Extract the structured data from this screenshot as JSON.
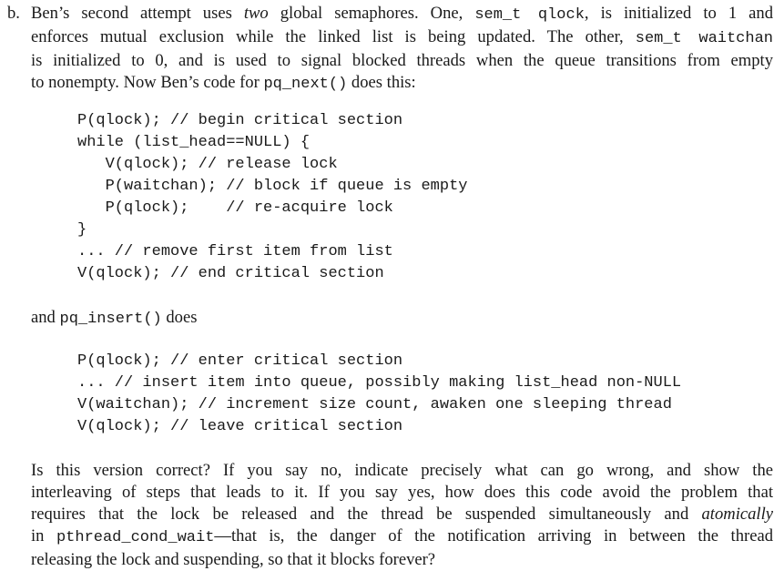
{
  "part_b": {
    "label": "b.",
    "lines": [
      [
        "Ben’s second attempt uses ",
        {
          "em": "two"
        },
        " global semaphores. One, ",
        {
          "tt": "sem_t qlock"
        },
        ", is initialized to 1 and"
      ],
      [
        "enforces mutual exclusion while the linked list is being updated. The other, ",
        {
          "tt": "sem_t waitchan"
        }
      ],
      [
        "is initialized to 0, and is used to signal blocked threads when the queue transitions from empty"
      ],
      [
        "to nonempty. Now Ben’s code for ",
        {
          "tt": "pq_next()"
        },
        " does this:"
      ]
    ]
  },
  "pq_next_code": [
    "P(qlock); // begin critical section",
    "while (list_head==NULL) {",
    "   V(qlock); // release lock",
    "   P(waitchan); // block if queue is empty",
    "   P(qlock);    // re-acquire lock",
    "}",
    "... // remove first item from list",
    "V(qlock); // end critical section"
  ],
  "insert_intro": {
    "before": "and ",
    "func": "pq_insert()",
    "after": " does"
  },
  "pq_insert_code": [
    "P(qlock); // enter critical section",
    "... // insert item into queue, possibly making list_head non-NULL",
    "V(waitchan); // increment size count, awaken one sleeping thread",
    "V(qlock); // leave critical section"
  ],
  "question": {
    "lines": [
      [
        "Is this version correct? If you say no, indicate precisely what can go wrong, and show the"
      ],
      [
        "interleaving of steps that leads to it. If you say yes, how does this code avoid the problem that"
      ],
      [
        "requires that the lock be released and the thread be suspended simultaneously and ",
        {
          "em": "atomically"
        }
      ],
      [
        "in ",
        {
          "tt": "pthread_cond_wait"
        },
        "—that is, the danger of the notification arriving in between the thread"
      ],
      [
        "releasing the lock and suspending, so that it blocks forever?"
      ]
    ]
  }
}
